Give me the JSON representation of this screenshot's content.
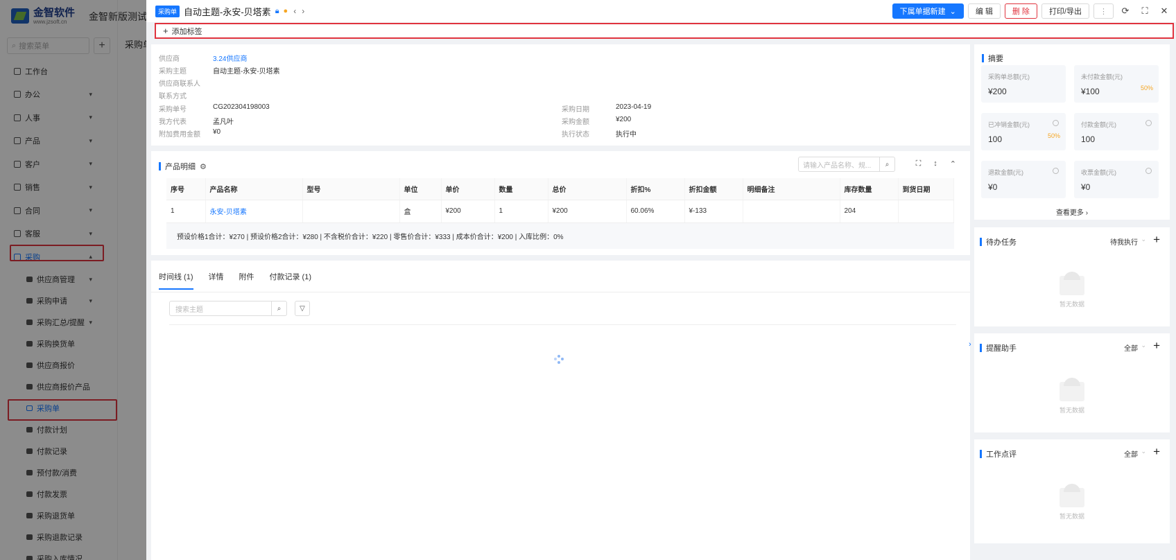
{
  "app": {
    "brand": "金智软件",
    "brand_url": "www.jzsoft.cn",
    "title": "金智新版测试公",
    "sidebar_search_placeholder": "搜索菜单",
    "page_crumb": "采购单"
  },
  "sidebar": {
    "items": [
      {
        "label": "工作台"
      },
      {
        "label": "办公"
      },
      {
        "label": "人事"
      },
      {
        "label": "产品"
      },
      {
        "label": "客户"
      },
      {
        "label": "销售"
      },
      {
        "label": "合同"
      },
      {
        "label": "客服"
      },
      {
        "label": "采购"
      }
    ],
    "sub_items": [
      {
        "label": "供应商管理"
      },
      {
        "label": "采购申请"
      },
      {
        "label": "采购汇总/提醒"
      },
      {
        "label": "采购换货单"
      },
      {
        "label": "供应商报价"
      },
      {
        "label": "供应商报价产品"
      },
      {
        "label": "采购单"
      },
      {
        "label": "付款计划"
      },
      {
        "label": "付款记录"
      },
      {
        "label": "预付款/消费"
      },
      {
        "label": "付款发票"
      },
      {
        "label": "采购退货单"
      },
      {
        "label": "采购退款记录"
      },
      {
        "label": "采购入库情况"
      }
    ]
  },
  "header": {
    "badge": "采购单",
    "title": "自动主题-永安-贝塔素",
    "btn_new": "下属单据新建",
    "btn_edit": "编 辑",
    "btn_delete": "删 除",
    "btn_print": "打印/导出",
    "btn_more": "⋮"
  },
  "tagbar": {
    "label": "添加标签"
  },
  "info": {
    "supplier_k": "供应商",
    "supplier_v": "3.24供应商",
    "subject_k": "采购主题",
    "subject_v": "自动主题-永安-贝塔素",
    "contact_k": "供应商联系人",
    "method_k": "联系方式",
    "number_k": "采购单号",
    "number_v": "CG202304198003",
    "rep_k": "我方代表",
    "rep_v": "孟凡叶",
    "extra_k": "附加费用金额",
    "extra_v": "¥0",
    "date_k": "采购日期",
    "date_v": "2023-04-19",
    "amount_k": "采购金额",
    "amount_v": "¥200",
    "status_k": "执行状态",
    "status_v": "执行中"
  },
  "products": {
    "title": "产品明细",
    "search_placeholder": "请输入产品名称、规...",
    "columns": [
      "序号",
      "产品名称",
      "型号",
      "单位",
      "单价",
      "数量",
      "总价",
      "折扣%",
      "折扣金额",
      "明细备注",
      "库存数量",
      "到货日期"
    ],
    "rows": [
      [
        "1",
        "永安-贝塔素",
        "",
        "盒",
        "¥200",
        "1",
        "¥200",
        "60.06%",
        "¥-133",
        "",
        "204",
        ""
      ]
    ],
    "summary": "预设价格1合计：¥270 |    预设价格2合计：¥280 |    不含税价合计：¥220 |    零售价合计：¥333 |    成本价合计：¥200 |    入库比例：0%"
  },
  "tabs": {
    "items": [
      {
        "label": "时间线 (1)"
      },
      {
        "label": "详情"
      },
      {
        "label": "附件"
      },
      {
        "label": "付款记录 (1)"
      }
    ],
    "search_placeholder": "搜索主题"
  },
  "summary": {
    "title": "摘要",
    "stats": [
      {
        "label": "采购单总额(元)",
        "value": "¥200",
        "pct": ""
      },
      {
        "label": "未付款金额(元)",
        "value": "¥100",
        "pct": "50%"
      },
      {
        "label": "已冲销金额(元)",
        "value": "100",
        "pct": "50%"
      },
      {
        "label": "付款金额(元)",
        "value": "100",
        "pct": ""
      },
      {
        "label": "退款金额(元)",
        "value": "¥0",
        "pct": ""
      },
      {
        "label": "收票金额(元)",
        "value": "¥0",
        "pct": ""
      }
    ],
    "see_more": "查看更多 ›"
  },
  "panels": [
    {
      "title": "待办任务",
      "filter": "待我执行",
      "empty": "暂无数据"
    },
    {
      "title": "提醒助手",
      "filter": "全部",
      "empty": "暂无数据"
    },
    {
      "title": "工作点评",
      "filter": "全部",
      "empty": "暂无数据"
    }
  ],
  "colors": {
    "primary": "#1677ff",
    "danger": "#e0333e",
    "warning": "#f5a623"
  }
}
